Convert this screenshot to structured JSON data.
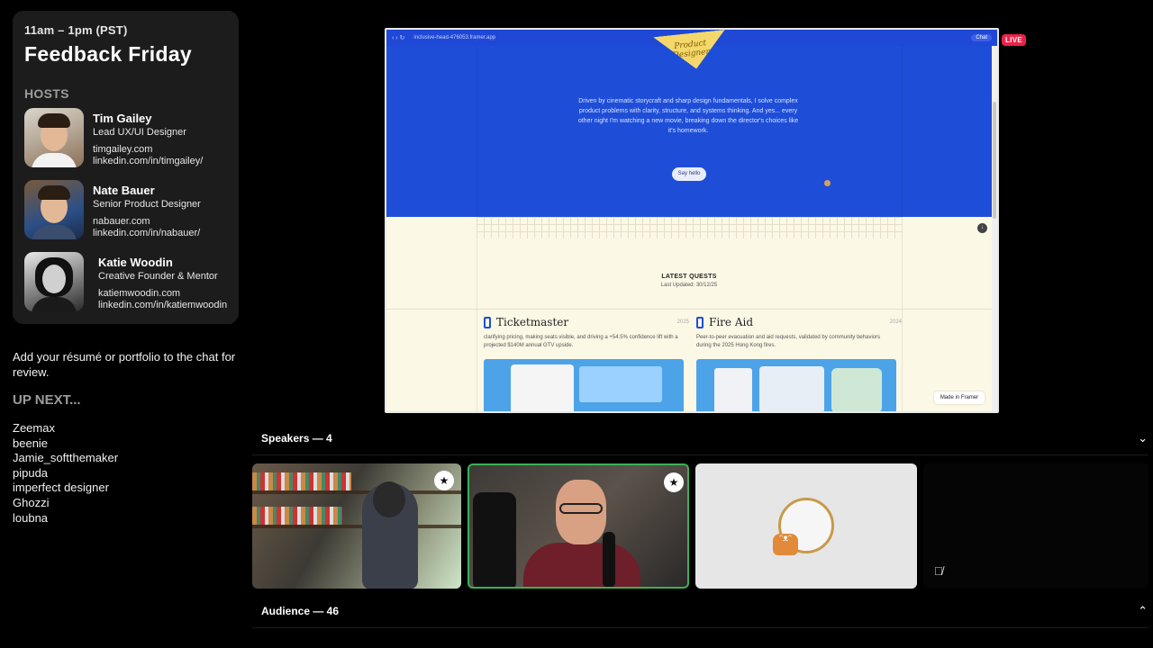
{
  "event": {
    "time": "11am – 1pm (PST)",
    "title": "Feedback Friday",
    "hosts_label": "HOSTS",
    "hosts": [
      {
        "name": "Tim Gailey",
        "role": "Lead UX/UI Designer",
        "link1": "timgailey.com",
        "link2": "linkedin.com/in/timgailey/"
      },
      {
        "name": "Nate Bauer",
        "role": "Senior Product Designer",
        "link1": "nabauer.com",
        "link2": "linkedin.com/in/nabauer/"
      },
      {
        "name": "Katie Woodin",
        "role": "Creative Founder & Mentor",
        "link1": "katiemwoodin.com",
        "link2": "linkedin.com/in/katiemwoodin"
      }
    ]
  },
  "chat_note": "Add your résumé or portfolio to the chat for review.",
  "up_next": {
    "label": "UP NEXT...",
    "queue": [
      "Zeemax",
      "beenie",
      "Jamie_softthemaker",
      "pipuda",
      "imperfect designer",
      "Ghozzi",
      "loubna"
    ]
  },
  "shared_screen": {
    "nav": "‹ › ↻",
    "url": "inclusive-head-476053.framer.app",
    "chat_label": "Chat",
    "sticky_note": "Product Designer",
    "hero_text": "Driven by cinematic storycraft and sharp design fundamentals, I solve complex product problems with clarity, structure, and systems thinking. And yes... every other night I'm watching a new movie, breaking down the director's choices like it's homework.",
    "say_hello": "Say hello",
    "quests_title": "LATEST QUESTS",
    "quests_date": "Last Updated: 30/12/25",
    "cards": [
      {
        "name": "Ticketmaster",
        "year": "2025",
        "desc": "clarifying pricing, making seats visible, and driving a +54.5% confidence lift with a projected $140M annual GTV upside."
      },
      {
        "name": "Fire Aid",
        "year": "2024",
        "desc": "Peer-to-peer evacuation and aid requests, validated by community behaviors during the 2025 Hong Kong fires."
      }
    ],
    "made_in": "Made in Framer"
  },
  "live_label": "LIVE",
  "speakers": {
    "label": "Speakers — 4"
  },
  "audience": {
    "label": "Audience — 46"
  },
  "icons": {
    "chevron_down": "chevron-down-icon",
    "chevron_up": "chevron-up-icon",
    "moderator": "shield-star-icon",
    "muted": "mic-muted-icon"
  },
  "colors": {
    "accent_live": "#e8234a",
    "active_speaker": "#3bb157",
    "hero_blue": "#1e4ed8"
  }
}
